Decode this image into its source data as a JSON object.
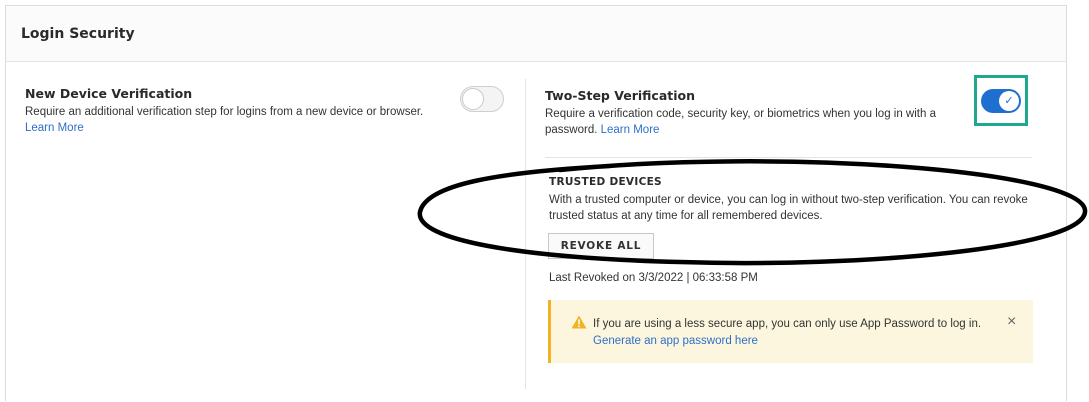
{
  "panel": {
    "title": "Login Security"
  },
  "new_device": {
    "title": "New Device Verification",
    "description": "Require an additional verification step for logins from a new device or browser.",
    "link": "Learn More",
    "toggle": "off"
  },
  "two_step": {
    "title": "Two-Step Verification",
    "description": "Require a verification code, security key, or biometrics when you log in with a password.",
    "link": "Learn More",
    "toggle": "on",
    "toggle_check": "✓"
  },
  "trusted_devices": {
    "title": "TRUSTED DEVICES",
    "description": "With a trusted computer or device, you can log in without two-step verification. You can revoke trusted status at any time for all remembered devices.",
    "revoke_button": "REVOKE ALL",
    "last_revoked": "Last Revoked on 3/3/2022 | 06:33:58 PM"
  },
  "alert": {
    "icon": "warning-icon",
    "text": "If you are using a less secure app, you can only use App Password to log in.",
    "link": "Generate an app password here",
    "close": "×"
  },
  "colors": {
    "accent_blue": "#1f6fd1",
    "link": "#2f6fc9",
    "highlight_box": "#1ea88f",
    "warning": "#f0b323",
    "warning_bg": "#fdf6df"
  }
}
